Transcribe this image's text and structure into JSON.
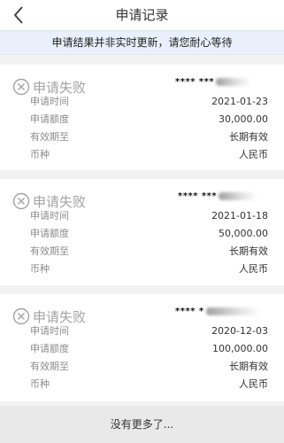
{
  "header": {
    "title": "申请记录",
    "back_icon": "chevron-left-icon"
  },
  "notice": "申请结果并非实时更新，请您耐心等待",
  "records": [
    {
      "status": "申请失败",
      "status_icon": "circle-x-icon",
      "account": "**** ***",
      "fields": [
        {
          "label": "申请时间",
          "value": "2021-01-23"
        },
        {
          "label": "申请额度",
          "value": "30,000.00"
        },
        {
          "label": "有效期至",
          "value": "长期有效"
        },
        {
          "label": "币种",
          "value": "人民币"
        }
      ]
    },
    {
      "status": "申请失败",
      "status_icon": "circle-x-icon",
      "account": "**** ***",
      "fields": [
        {
          "label": "申请时间",
          "value": "2021-01-18"
        },
        {
          "label": "申请额度",
          "value": "50,000.00"
        },
        {
          "label": "有效期至",
          "value": "长期有效"
        },
        {
          "label": "币种",
          "value": "人民币"
        }
      ]
    },
    {
      "status": "申请失败",
      "status_icon": "circle-x-icon",
      "account": "**** *",
      "fields": [
        {
          "label": "申请时间",
          "value": "2020-12-03"
        },
        {
          "label": "申请额度",
          "value": "100,000.00"
        },
        {
          "label": "有效期至",
          "value": "长期有效"
        },
        {
          "label": "币种",
          "value": "人民币"
        }
      ]
    }
  ],
  "footer": "没有更多了..."
}
